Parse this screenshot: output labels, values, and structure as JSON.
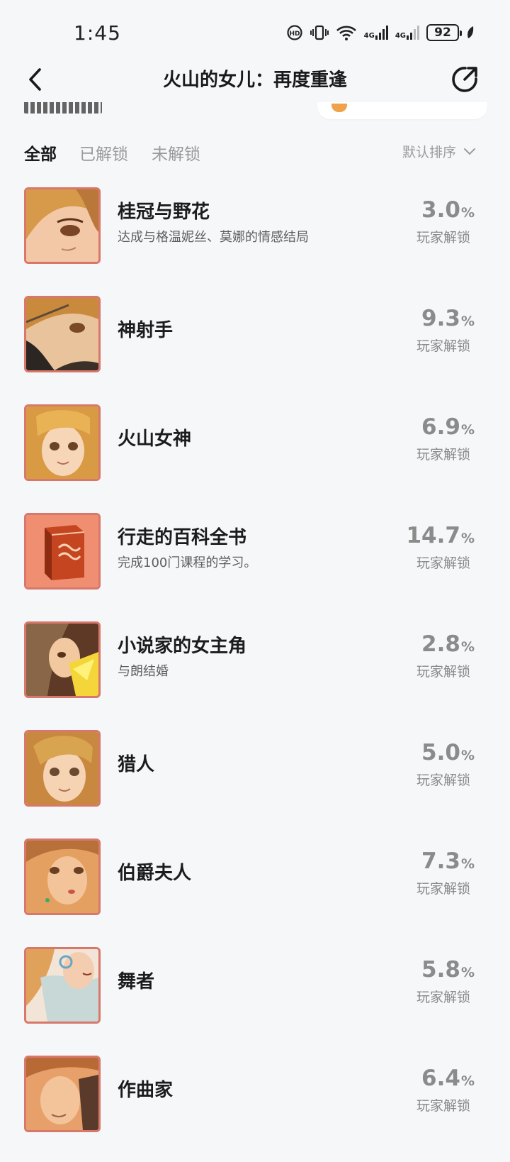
{
  "status_bar": {
    "time": "1:45",
    "battery": "92",
    "net1": "4G",
    "net2": "4G"
  },
  "header": {
    "title": "火山的女儿：再度重逢"
  },
  "tabs": [
    {
      "label": "全部",
      "active": true
    },
    {
      "label": "已解锁",
      "active": false
    },
    {
      "label": "未解锁",
      "active": false
    }
  ],
  "sort": {
    "label": "默认排序"
  },
  "unlock_label": "玩家解锁",
  "percent_sign": "%",
  "achievements": [
    {
      "title": "桂冠与野花",
      "desc": "达成与格温妮丝、莫娜的情感结局",
      "percent": "3.0",
      "icon": "portrait-laurel"
    },
    {
      "title": "神射手",
      "desc": "",
      "percent": "9.3",
      "icon": "portrait-sharpshooter"
    },
    {
      "title": "火山女神",
      "desc": "",
      "percent": "6.9",
      "icon": "portrait-volcano-goddess"
    },
    {
      "title": "行走的百科全书",
      "desc": "完成100门课程的学习。",
      "percent": "14.7",
      "icon": "book-icon"
    },
    {
      "title": "小说家的女主角",
      "desc": "与朗结婚",
      "percent": "2.8",
      "icon": "portrait-novelist"
    },
    {
      "title": "猎人",
      "desc": "",
      "percent": "5.0",
      "icon": "portrait-hunter"
    },
    {
      "title": "伯爵夫人",
      "desc": "",
      "percent": "7.3",
      "icon": "portrait-countess"
    },
    {
      "title": "舞者",
      "desc": "",
      "percent": "5.8",
      "icon": "portrait-dancer"
    },
    {
      "title": "作曲家",
      "desc": "",
      "percent": "6.4",
      "icon": "portrait-composer"
    }
  ],
  "colors": {
    "background": "#f6f7f9",
    "thumb_border": "#d8786b",
    "percent": "#8b8b8b"
  }
}
